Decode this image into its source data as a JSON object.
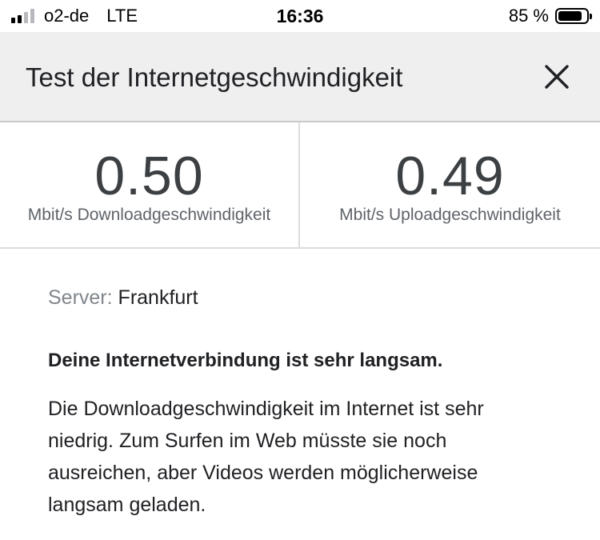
{
  "status_bar": {
    "carrier": "o2-de",
    "network": "LTE",
    "time": "16:36",
    "battery": "85 %",
    "battery_level": 0.85,
    "signal_bars_active": 2,
    "signal_bars_total": 4
  },
  "header": {
    "title": "Test der Internetgeschwindigkeit",
    "close_icon": "close-icon"
  },
  "results": {
    "download": {
      "value": "0.50",
      "label": "Mbit/s Downloadgeschwindigkeit"
    },
    "upload": {
      "value": "0.49",
      "label": "Mbit/s Uploadgeschwindigkeit"
    }
  },
  "details": {
    "server_label": "Server:",
    "server_value": "Frankfurt",
    "headline": "Deine Internetverbindung ist sehr langsam.",
    "description": "Die Downloadgeschwindigkeit im Internet ist sehr niedrig. Zum Surfen im Web müsste sie noch ausreichen, aber Videos werden möglicherweise langsam geladen."
  },
  "colors": {
    "header_bg": "#efeff0",
    "value_text": "#3c4043",
    "muted_text": "#5f6368",
    "signal_active": "#000000",
    "signal_inactive": "#b9b9bd"
  }
}
